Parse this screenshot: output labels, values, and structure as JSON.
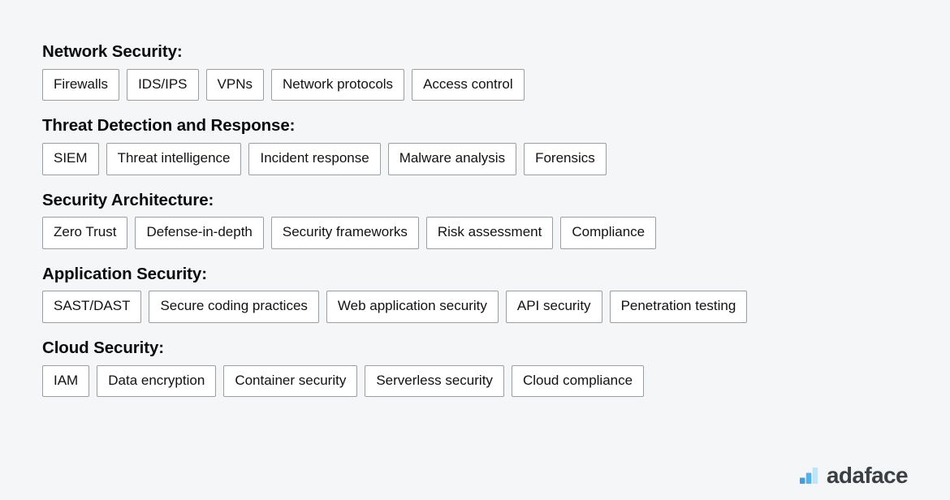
{
  "background_color": "#f5f6f7",
  "sections": [
    {
      "heading": "Network Security:",
      "tags": [
        "Firewalls",
        "IDS/IPS",
        "VPNs",
        "Network protocols",
        "Access control"
      ]
    },
    {
      "heading": "Threat Detection and Response:",
      "tags": [
        "SIEM",
        "Threat intelligence",
        "Incident response",
        "Malware analysis",
        "Forensics"
      ]
    },
    {
      "heading": "Security Architecture:",
      "tags": [
        "Zero Trust",
        "Defense-in-depth",
        "Security frameworks",
        "Risk assessment",
        "Compliance"
      ]
    },
    {
      "heading": "Application Security:",
      "tags": [
        "SAST/DAST",
        "Secure coding practices",
        "Web application security",
        "API security",
        "Penetration testing"
      ]
    },
    {
      "heading": "Cloud Security:",
      "tags": [
        "IAM",
        "Data encryption",
        "Container security",
        "Serverless security",
        "Cloud compliance"
      ]
    }
  ],
  "brand": {
    "name": "adaface",
    "logo_icon": "bar-chart-logo-icon",
    "logo_colors": {
      "bar_small": "#3f9fe0",
      "bar_medium": "#4fb3ef",
      "bar_tall": "#bfe3f7"
    },
    "text_color": "#3a3f45"
  }
}
